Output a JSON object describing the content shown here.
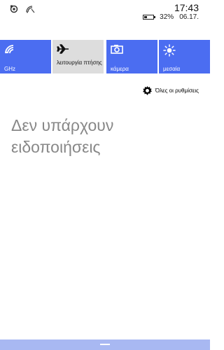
{
  "status_bar": {
    "time": "17:43",
    "battery_percent": "32%",
    "date": "06.17.",
    "battery_level": 0.32,
    "icons": [
      "notification-app-icon",
      "wifi-off-icon"
    ]
  },
  "tiles": [
    {
      "label": "GHz",
      "icon": "wifi-icon",
      "active": true
    },
    {
      "label": "λειτουργία πτήσης",
      "icon": "airplane-icon",
      "active": false
    },
    {
      "label": "κάμερα",
      "icon": "camera-icon",
      "active": true
    },
    {
      "label": "μεσαία",
      "icon": "brightness-icon",
      "active": true
    }
  ],
  "settings_link": {
    "label": "Όλες οι ρυθμίσεις",
    "icon": "gear-icon"
  },
  "empty_state": {
    "text": "Δεν υπάρχουν ειδοποιήσεις"
  },
  "colors": {
    "accent": "#4b6df1",
    "inactive_tile": "#dddddd",
    "bottom_bar": "#a8b8f2",
    "muted_text": "#888888"
  }
}
